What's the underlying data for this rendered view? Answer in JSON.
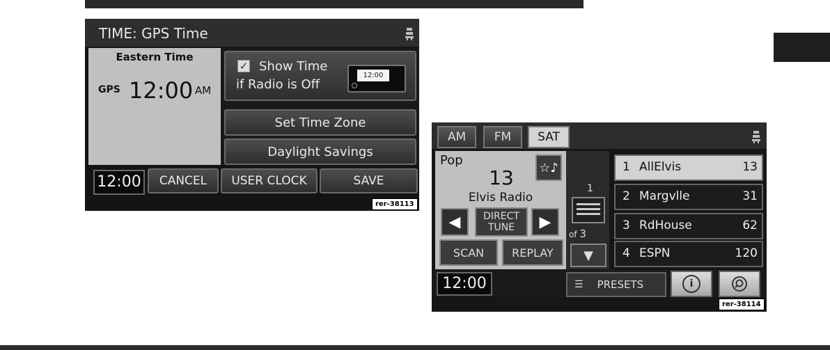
{
  "time_screen": {
    "title": "TIME: GPS Time",
    "zone": "Eastern Time",
    "source": "GPS",
    "time": "12:00",
    "ampm": "AM",
    "show_time_line1": "Show Time",
    "show_time_line2": "if Radio is Off",
    "show_time_checked": true,
    "preview_time": "12:00",
    "set_time_zone": "Set Time Zone",
    "daylight_savings": "Daylight Savings",
    "bottom": {
      "clock": "12:00",
      "cancel": "CANCEL",
      "user_clock": "USER CLOCK",
      "save": "SAVE"
    },
    "code": "rer-38113"
  },
  "radio_screen": {
    "bands": [
      "AM",
      "FM",
      "SAT"
    ],
    "selected_band": "SAT",
    "genre": "Pop",
    "channel": "13",
    "channel_name": "Elvis Radio",
    "direct_tune_1": "DIRECT",
    "direct_tune_2": "TUNE",
    "scan": "SCAN",
    "replay": "REPLAY",
    "page_current": "1",
    "page_of": "of",
    "page_total": "3",
    "presets": [
      {
        "num": "1",
        "name": "AllElvis",
        "ch": "13"
      },
      {
        "num": "2",
        "name": "Margvlle",
        "ch": "31"
      },
      {
        "num": "3",
        "name": "RdHouse",
        "ch": "62"
      },
      {
        "num": "4",
        "name": "ESPN",
        "ch": "120"
      }
    ],
    "selected_preset": 1,
    "bottom": {
      "clock": "12:00",
      "presets": "PRESETS",
      "info_icon": "i"
    },
    "code": "rer-38114"
  }
}
